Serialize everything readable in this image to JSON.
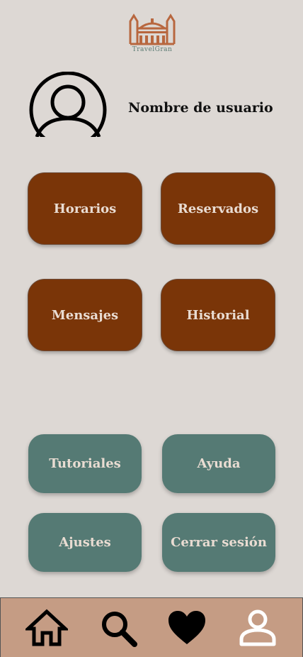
{
  "app": {
    "logo_text": "TravelGran"
  },
  "profile": {
    "username": "Nombre de usuario"
  },
  "primary_buttons": {
    "horarios": "Horarios",
    "reservados": "Reservados",
    "mensajes": "Mensajes",
    "historial": "Historial"
  },
  "secondary_buttons": {
    "tutoriales": "Tutoriales",
    "ayuda": "Ayuda",
    "ajustes": "Ajustes",
    "cerrar_sesion": "Cerrar sesión"
  },
  "bottom_nav": {
    "items": [
      {
        "icon": "home-icon"
      },
      {
        "icon": "search-icon"
      },
      {
        "icon": "heart-icon"
      },
      {
        "icon": "person-icon"
      }
    ]
  },
  "colors": {
    "background": "#ddd8d4",
    "primary_button": "#7a3508",
    "secondary_button": "#557a74",
    "nav_bar": "#c59c84",
    "button_text": "#e9dcd2",
    "logo": "#b8673f"
  }
}
